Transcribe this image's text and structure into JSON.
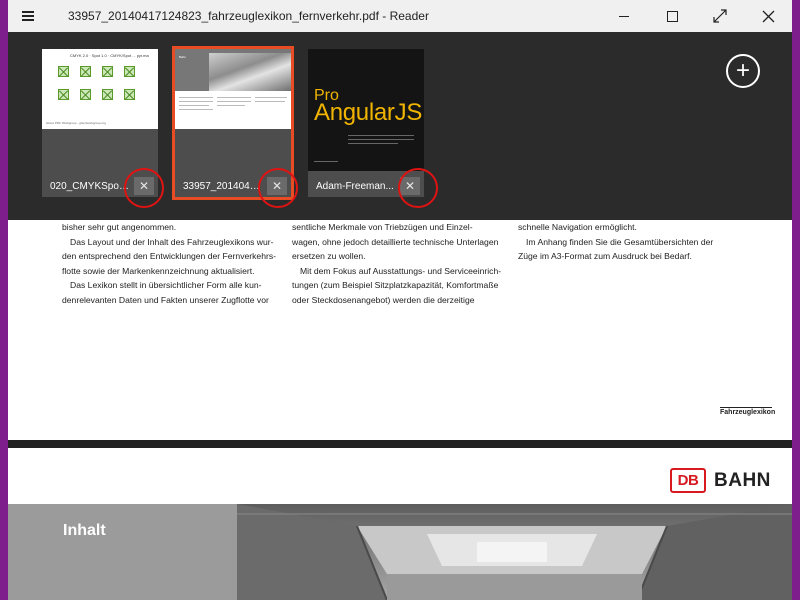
{
  "window": {
    "title": "33957_20140417124823_fahrzeuglexikon_fernverkehr.pdf - Reader",
    "controls": [
      "minimize",
      "maximize",
      "fullscreen",
      "close"
    ]
  },
  "tabs": [
    {
      "label": "020_CMYKSpot_...",
      "close": "✕",
      "thumb": {
        "header": "CMYK 2.0 · Spot 1.0 · CMYK/Spot ... pyr.ma",
        "footer": "Ghent PDF Workgroup - ghentworkgroup.org"
      }
    },
    {
      "label": "33957_2014041...",
      "close": "✕",
      "active": true,
      "thumb": {
        "brand": "Bahn"
      }
    },
    {
      "label": "Adam-Freeman...",
      "close": "✕",
      "thumb": {
        "pro": "Pro",
        "title": "AngularJS"
      }
    }
  ],
  "add_tab": "+",
  "document": {
    "col1": [
      "bisher sehr gut angenommen.",
      "Das Layout und der Inhalt des Fahrzeuglexikons wur-",
      "den entsprechend den Entwicklungen der Fernverkehrs-",
      "flotte sowie der Markenkennzeichnung aktualisiert.",
      "Das Lexikon stellt in übersichtlicher Form alle kun-",
      "denrelevanten Daten und Fakten unserer Zugflotte vor"
    ],
    "col2": [
      "sentliche Merkmale von Triebzügen und Einzel-",
      "wagen, ohne jedoch detaillierte technische Unterlagen",
      "ersetzen zu wollen.",
      "Mit dem Fokus auf Ausstattungs- und Serviceeinrich-",
      "tungen (zum Beispiel Sitzplatzkapazität, Komfortmaße",
      "oder Steckdosenangebot) werden die derzeitige"
    ],
    "col3": [
      "schnelle Navigation ermöglicht.",
      "Im Anhang  finden Sie die Gesamtübersichten der",
      "Züge im A3-Format zum Ausdruck bei Bedarf."
    ],
    "footer": "Fahrzeuglexikon",
    "logo_db": "DB",
    "logo_bahn": "BAHN",
    "section_title": "Inhalt"
  },
  "colors": {
    "accent": "#e84c24",
    "ring": "#e01313",
    "desktop": "#7d1e8c",
    "db_red": "#d71920"
  }
}
